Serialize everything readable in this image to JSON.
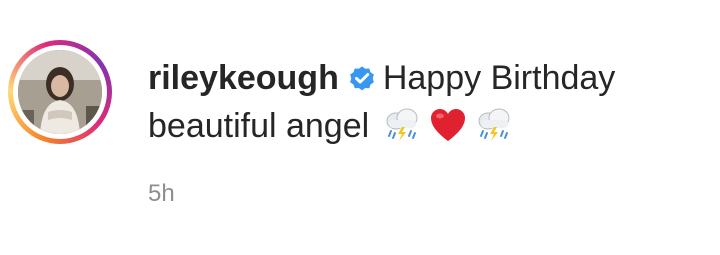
{
  "comment": {
    "username": "rileykeough",
    "verified": true,
    "text_line1": "Happy Birthday",
    "text_line2": "beautiful angel",
    "emojis": [
      "cloud-rain-lightning-icon",
      "red-heart-icon",
      "cloud-rain-lightning-icon"
    ],
    "timestamp": "5h"
  },
  "colors": {
    "text": "#262626",
    "muted": "#8e8e8e",
    "verified_blue": "#3897f0",
    "heart_red": "#e0212f",
    "story_ring": [
      "#f58529",
      "#feda77",
      "#dd2a7b",
      "#8134af"
    ]
  }
}
